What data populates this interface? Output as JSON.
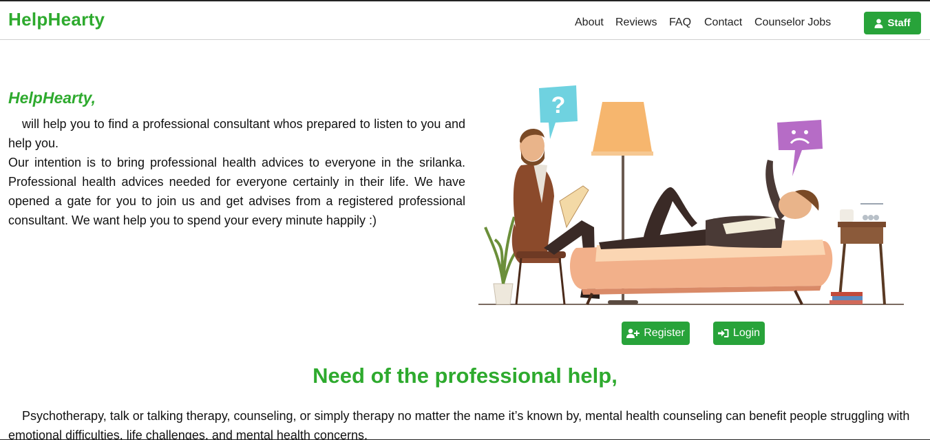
{
  "nav": {
    "brand": "HelpHearty",
    "links": [
      {
        "label": "About"
      },
      {
        "label": "Reviews"
      },
      {
        "label": "FAQ"
      },
      {
        "label": "Contact"
      },
      {
        "label": "Counselor Jobs"
      }
    ],
    "staff_label": "Staff",
    "staff_icon": "user-icon"
  },
  "intro": {
    "title": "HelpHearty,",
    "paragraph1": "will help you to find a professional consultant whos prepared to listen to you and help you.",
    "paragraph2": "Our intention is to bring professional health advices to everyone in the srilanka. Professional health advices needed for everyone certainly in their life. We have opened a gate for you to join us and get advises from a registered professional consultant. We want help you to spend your every minute happily :)"
  },
  "auth": {
    "register_label": "Register",
    "register_icon": "user-plus-icon",
    "login_label": "Login",
    "login_icon": "sign-in-icon"
  },
  "section": {
    "heading": "Need of the professional help,",
    "text": "Psychotherapy, talk or talking therapy, counseling, or simply therapy no matter the name it’s known by, mental health counseling can benefit people struggling with emotional difficulties, life challenges, and mental health concerns."
  },
  "colors": {
    "brand_green": "#2eaa2e",
    "button_green": "#28a33a"
  }
}
